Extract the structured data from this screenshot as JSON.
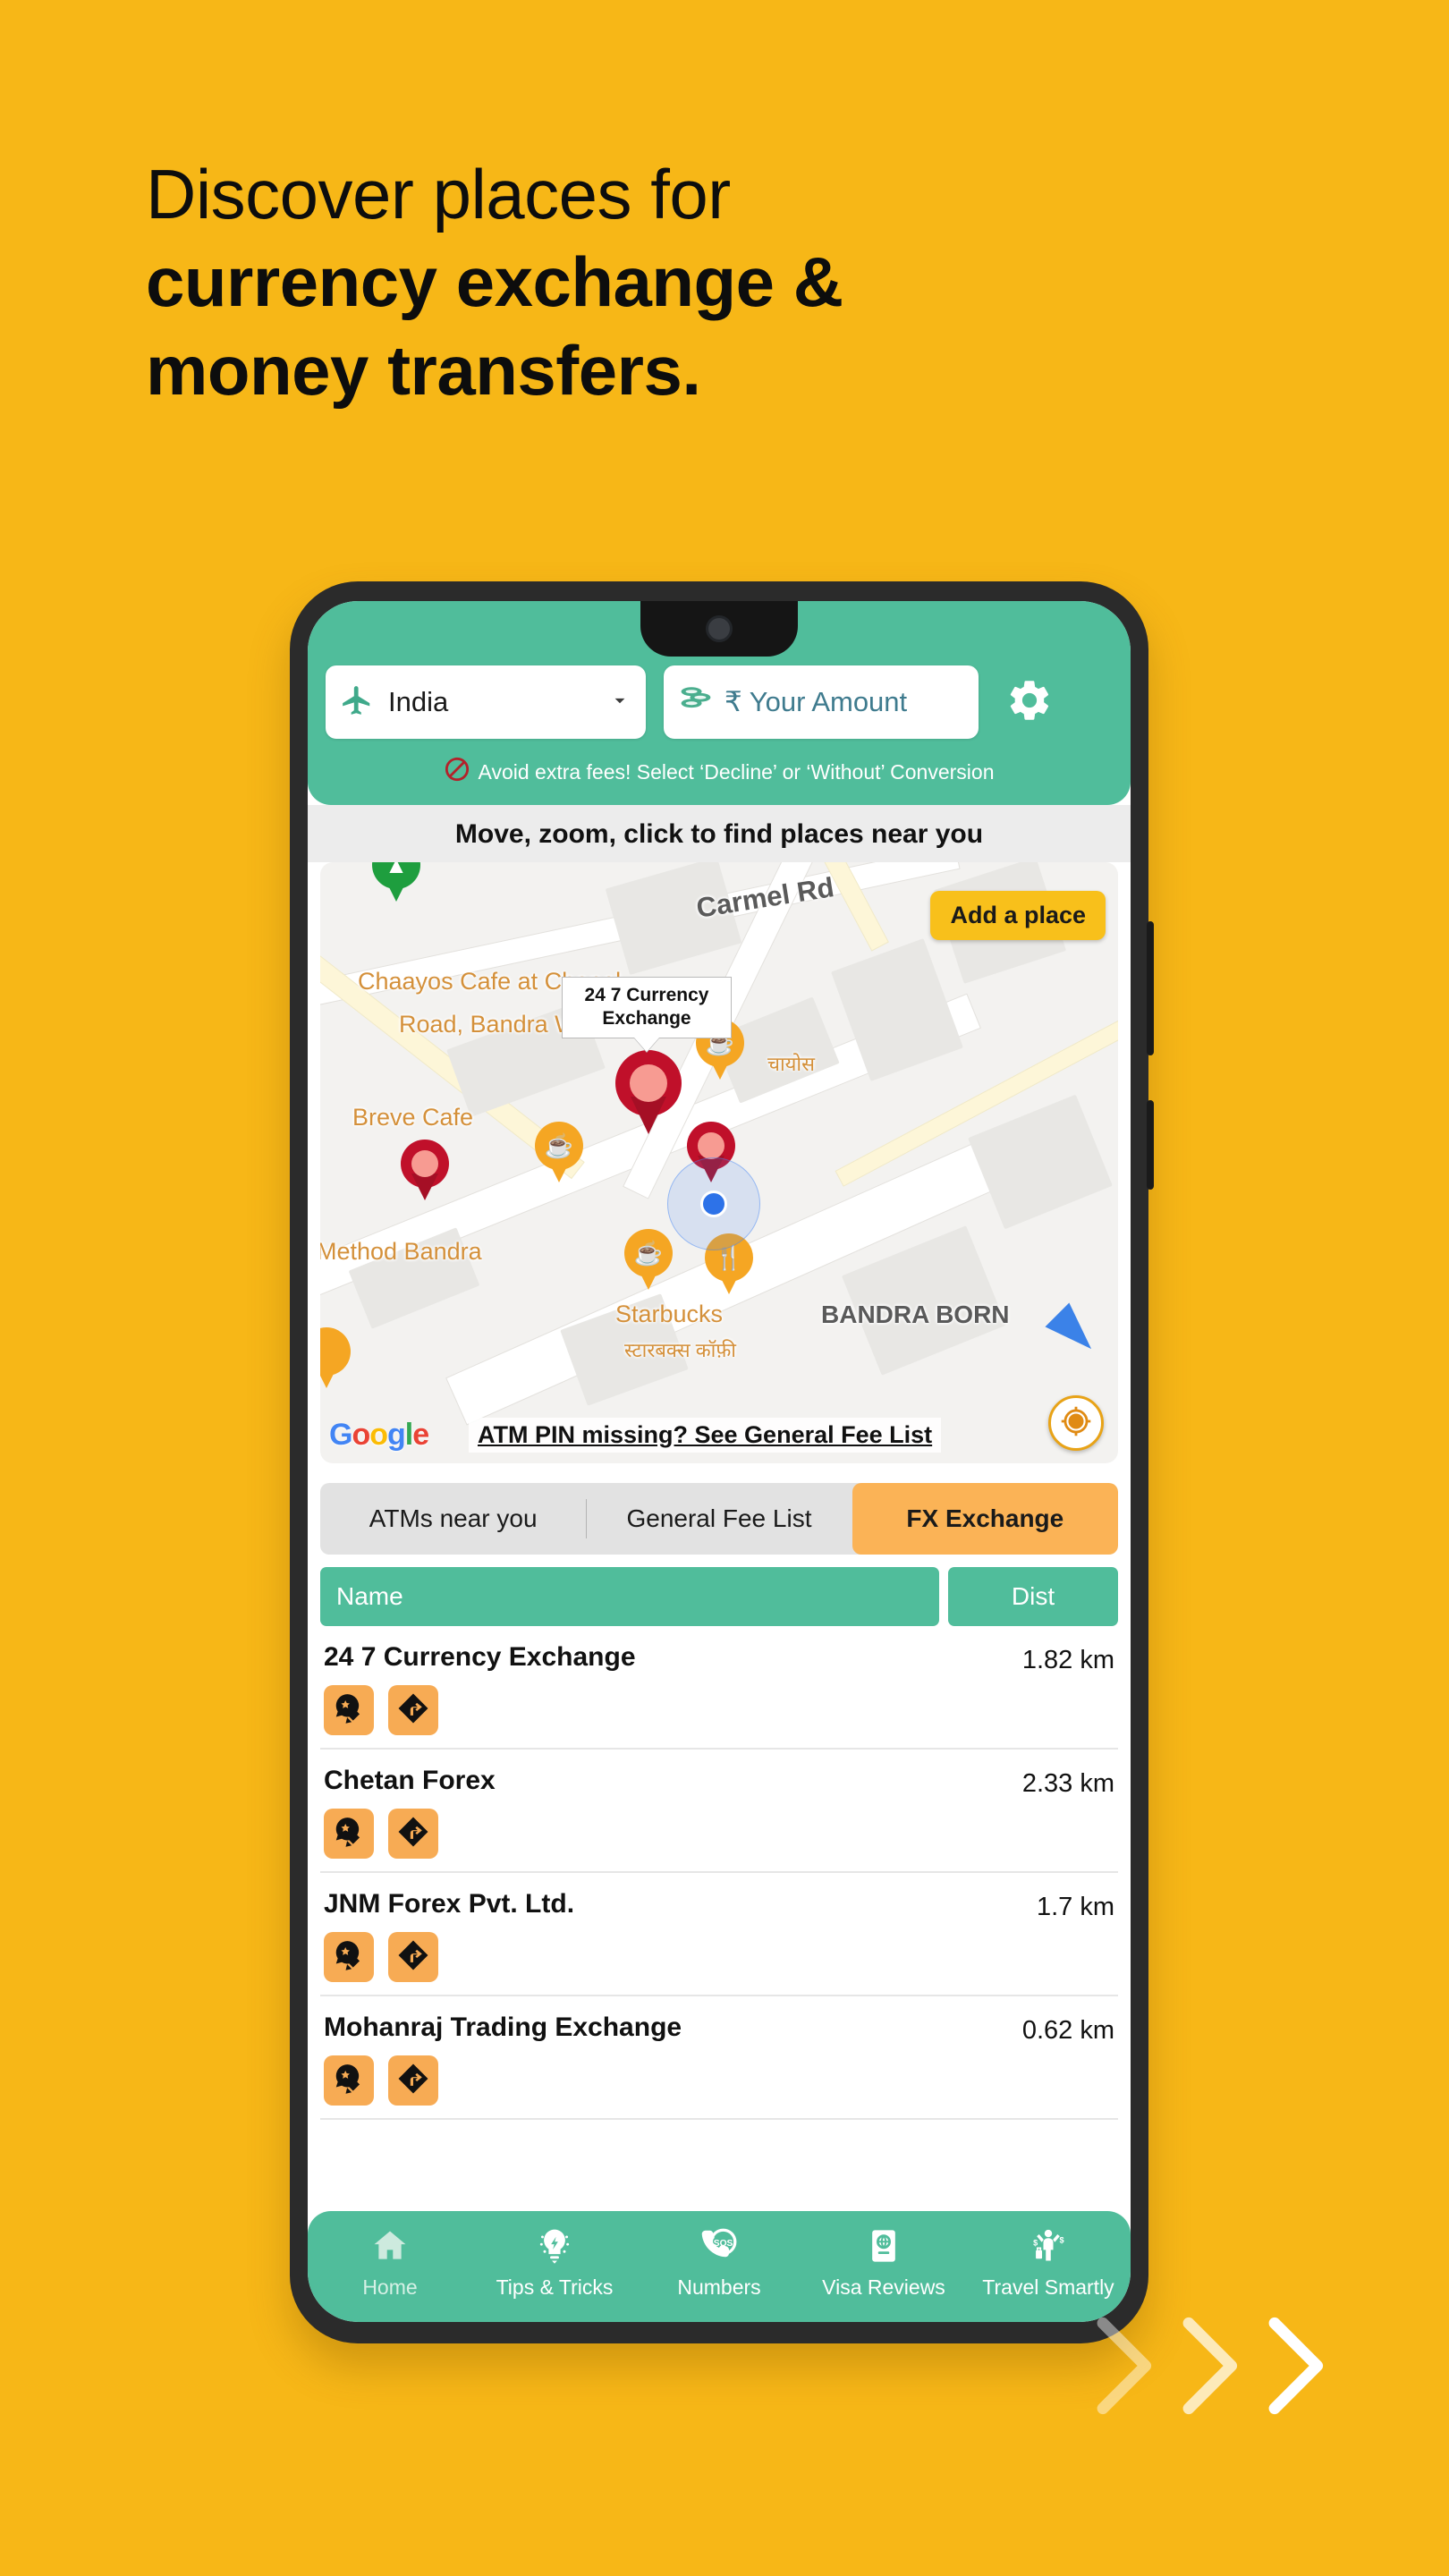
{
  "background_color": "#F7B717",
  "headline": {
    "line1": "Discover places for",
    "line2": "currency exchange &",
    "line3": "money transfers."
  },
  "app": {
    "header": {
      "country": {
        "icon": "airplane-icon",
        "value": "India",
        "dropdown_icon": "chevron-down-icon"
      },
      "amount": {
        "icon": "coins-icon",
        "placeholder": "₹ Your Amount"
      },
      "settings_icon": "gear-icon",
      "notice": {
        "icon": "no-entry-icon",
        "text": "Avoid extra fees! Select ‘Decline’ or ‘Without’ Conversion"
      }
    },
    "instruction": "Move, zoom, click to find places near you",
    "map": {
      "add_place_label": "Add a place",
      "tooltip": "24 7 Currency Exchange",
      "fee_link": "ATM PIN missing? See General Fee List",
      "google_logo": "Google",
      "locate_icon": "my-location-icon",
      "labels": [
        {
          "text": "Carmel Rd",
          "kind": "grey"
        },
        {
          "text": "Chaayos Cafe at Chapel",
          "kind": "poi"
        },
        {
          "text": "Road, Bandra West",
          "kind": "poi"
        },
        {
          "text": "चायोस",
          "kind": "poi"
        },
        {
          "text": "Breve Cafe",
          "kind": "poi"
        },
        {
          "text": "Method Bandra",
          "kind": "poi"
        },
        {
          "text": "Starbucks",
          "kind": "poi"
        },
        {
          "text": "स्टारबक्स कॉफ़ी",
          "kind": "poi"
        },
        {
          "text": "BANDRA BORN",
          "kind": "grey"
        }
      ]
    },
    "tabs": [
      {
        "label": "ATMs near you",
        "active": false
      },
      {
        "label": "General Fee List",
        "active": false
      },
      {
        "label": "FX Exchange",
        "active": true
      }
    ],
    "columns": {
      "name": "Name",
      "dist": "Dist"
    },
    "places": [
      {
        "name": "24 7 Currency Exchange",
        "dist": "1.82 km"
      },
      {
        "name": "Chetan Forex",
        "dist": "2.33 km"
      },
      {
        "name": "JNM Forex Pvt. Ltd.",
        "dist": "1.7 km"
      },
      {
        "name": "Mohanraj Trading Exchange",
        "dist": "0.62 km"
      }
    ],
    "row_actions": {
      "review_icon": "review-edit-icon",
      "directions_icon": "directions-icon"
    },
    "bottom_nav": [
      {
        "label": "Home",
        "icon": "home-icon",
        "active": true
      },
      {
        "label": "Tips & Tricks",
        "icon": "lightbulb-icon",
        "active": false
      },
      {
        "label": "Numbers",
        "icon": "sos-phone-icon",
        "active": false
      },
      {
        "label": "Visa Reviews",
        "icon": "passport-icon",
        "active": false
      },
      {
        "label": "Travel Smartly",
        "icon": "traveler-icon",
        "active": false
      }
    ]
  },
  "chevrons_icon": "chevron-right-triple-icon",
  "colors": {
    "brand_yellow": "#F7B717",
    "teal": "#50BD9B",
    "orange_active": "#FBB356",
    "action_orange": "#F7AB54"
  }
}
